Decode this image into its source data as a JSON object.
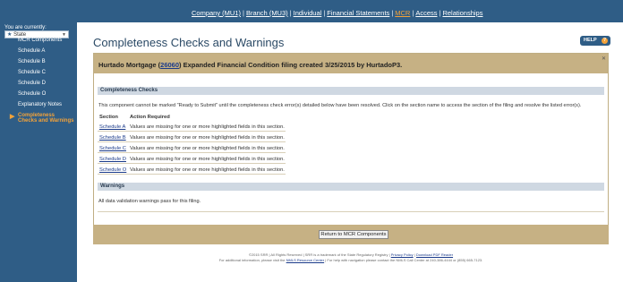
{
  "nav": {
    "items": [
      {
        "label": "Company (MU1)",
        "active": false
      },
      {
        "label": "Branch (MU3)",
        "active": false
      },
      {
        "label": "Individual",
        "active": false
      },
      {
        "label": "Financial Statements",
        "active": false
      },
      {
        "label": "MCR",
        "active": true
      },
      {
        "label": "Access",
        "active": false
      },
      {
        "label": "Relationships",
        "active": false
      }
    ]
  },
  "sidebar": {
    "you_are_currently": "You are currently:",
    "state_value": "State",
    "items": [
      {
        "label": "MCR Components"
      },
      {
        "label": "Schedule A"
      },
      {
        "label": "Schedule B"
      },
      {
        "label": "Schedule C"
      },
      {
        "label": "Schedule D"
      },
      {
        "label": "Schedule O"
      },
      {
        "label": "Explanatory Notes"
      },
      {
        "label": "Completeness",
        "label2": "Checks and Warnings",
        "active": true
      }
    ]
  },
  "page": {
    "title": "Completeness Checks and Warnings",
    "help_label": "HELP",
    "help_glyph": "?"
  },
  "panel": {
    "header_prefix": "Hurtado Mortgage (",
    "header_link": "26060",
    "header_suffix": ") Expanded Financial Condition filing created 3/25/2015 by HurtadoP3.",
    "completeness_title": "Completeness Checks",
    "completeness_text": "This component cannot be marked \"Ready to Submit\" until the completeness check error(s) detailed below have been resolved. Click on the section name to access the section of the filing and resolve the listed error(s).",
    "col_section": "Section",
    "col_action": "Action Required",
    "rows": [
      {
        "section": "Schedule A",
        "action": "Values are missing for one or more highlighted fields in this section."
      },
      {
        "section": "Schedule B",
        "action": "Values are missing for one or more highlighted fields in this section."
      },
      {
        "section": "Schedule C",
        "action": "Values are missing for one or more highlighted fields in this section."
      },
      {
        "section": "Schedule D",
        "action": "Values are missing for one or more highlighted fields in this section."
      },
      {
        "section": "Schedule O",
        "action": "Values are missing for one or more highlighted fields in this section."
      }
    ],
    "warnings_title": "Warnings",
    "warnings_text": "All data validation warnings pass for this filing.",
    "return_button": "Return to MCR Components"
  },
  "footer": {
    "line1_prefix": "©2015 SRR | All Rights Reserved | SRR is a trademark of the State Regulatory Registry | ",
    "line1_link1": "Privacy Policy",
    "line1_sep": " | ",
    "line1_link2": "Download PDF Reader",
    "line2_prefix": "For additional information, please visit the ",
    "line2_link": "NMLS Resource Center",
    "line2_suffix": " | For help with navigation please contact the NMLS Call Center at 240-386-4444 or (855) 665-7123."
  },
  "colors": {
    "nav_bg": "#2f5d86",
    "accent": "#f2a23a",
    "panel_header": "#c6b184",
    "section_bar": "#cfd8e2",
    "link": "#1a3a8a"
  }
}
